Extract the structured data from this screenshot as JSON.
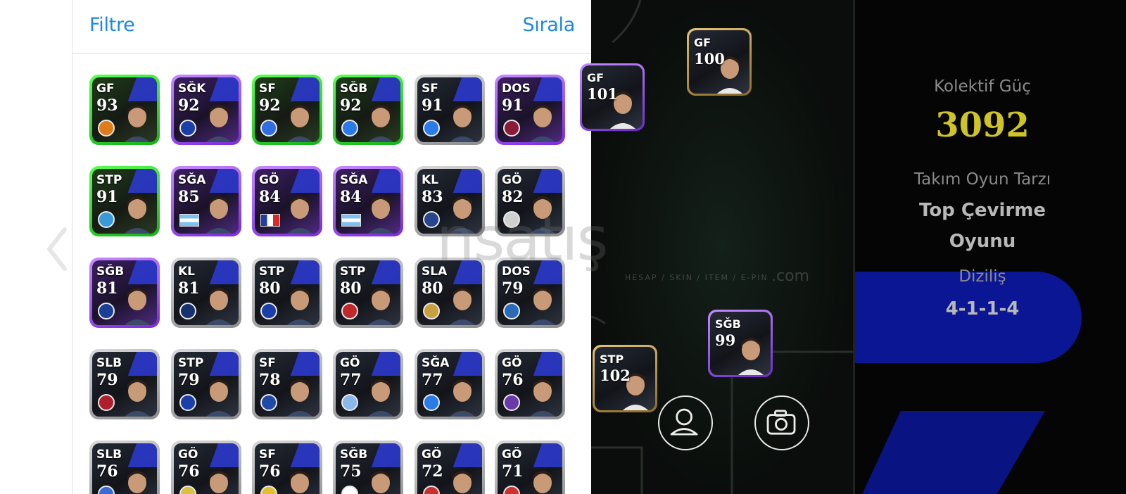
{
  "header": {
    "filter_label": "Filtre",
    "sort_label": "Sırala"
  },
  "cards": [
    {
      "pos": "GF",
      "rating": "93",
      "border": "green",
      "badge": "crest",
      "crest": "#e07b1a"
    },
    {
      "pos": "SĞK",
      "rating": "92",
      "border": "purple",
      "badge": "crest",
      "crest": "#1c3ea8"
    },
    {
      "pos": "SF",
      "rating": "92",
      "border": "green",
      "badge": "crest",
      "crest": "#2f6de0"
    },
    {
      "pos": "SĞB",
      "rating": "92",
      "border": "green",
      "badge": "crest",
      "crest": "#2a7be8"
    },
    {
      "pos": "SF",
      "rating": "91",
      "border": "grey",
      "badge": "crest",
      "crest": "#2a7be8"
    },
    {
      "pos": "DOS",
      "rating": "91",
      "border": "purple",
      "badge": "crest",
      "crest": "#8a1c3a"
    },
    {
      "pos": "STP",
      "rating": "91",
      "border": "green",
      "badge": "crest",
      "crest": "#3a9ad8"
    },
    {
      "pos": "SĞA",
      "rating": "85",
      "border": "purple",
      "badge": "flag",
      "flag": "argentina"
    },
    {
      "pos": "GÖ",
      "rating": "84",
      "border": "purple",
      "badge": "flag",
      "flag": "france"
    },
    {
      "pos": "SĞA",
      "rating": "84",
      "border": "purple",
      "badge": "flag",
      "flag": "argentina"
    },
    {
      "pos": "KL",
      "rating": "83",
      "border": "grey",
      "badge": "crest",
      "crest": "#27458f"
    },
    {
      "pos": "GÖ",
      "rating": "82",
      "border": "grey",
      "badge": "crest",
      "crest": "#d0d0d0"
    },
    {
      "pos": "SĞB",
      "rating": "81",
      "border": "purple",
      "badge": "crest",
      "crest": "#1b3f96"
    },
    {
      "pos": "KL",
      "rating": "81",
      "border": "grey",
      "badge": "crest",
      "crest": "#17306e"
    },
    {
      "pos": "STP",
      "rating": "80",
      "border": "grey",
      "badge": "crest",
      "crest": "#1c3ea8"
    },
    {
      "pos": "STP",
      "rating": "80",
      "border": "grey",
      "badge": "crest",
      "crest": "#c0282a"
    },
    {
      "pos": "SLA",
      "rating": "80",
      "border": "grey",
      "badge": "crest",
      "crest": "#c9a040"
    },
    {
      "pos": "DOS",
      "rating": "79",
      "border": "grey",
      "badge": "crest",
      "crest": "#2a6bb8"
    },
    {
      "pos": "SLB",
      "rating": "79",
      "border": "grey",
      "badge": "crest",
      "crest": "#b01e2e"
    },
    {
      "pos": "STP",
      "rating": "79",
      "border": "grey",
      "badge": "crest",
      "crest": "#1c3ea8"
    },
    {
      "pos": "SF",
      "rating": "78",
      "border": "grey",
      "badge": "crest",
      "crest": "#1f4aa8"
    },
    {
      "pos": "GÖ",
      "rating": "77",
      "border": "grey",
      "badge": "crest",
      "crest": "#8ab8e8"
    },
    {
      "pos": "SĞA",
      "rating": "77",
      "border": "grey",
      "badge": "crest",
      "crest": "#2a7be8"
    },
    {
      "pos": "GÖ",
      "rating": "76",
      "border": "grey",
      "badge": "crest",
      "crest": "#6a3aa8"
    },
    {
      "pos": "SLB",
      "rating": "76",
      "border": "grey",
      "badge": "crest",
      "crest": "#3a6ad8"
    },
    {
      "pos": "GÖ",
      "rating": "76",
      "border": "grey",
      "badge": "crest",
      "crest": "#d8c040"
    },
    {
      "pos": "SF",
      "rating": "76",
      "border": "grey",
      "badge": "crest",
      "crest": "#e0c030"
    },
    {
      "pos": "SĞB",
      "rating": "75",
      "border": "grey",
      "badge": "crest",
      "crest": "#ffffff"
    },
    {
      "pos": "GÖ",
      "rating": "72",
      "border": "grey",
      "badge": "crest",
      "crest": "#c83030"
    },
    {
      "pos": "GÖ",
      "rating": "71",
      "border": "grey",
      "badge": "crest",
      "crest": "#d03030"
    }
  ],
  "pitch_cards": [
    {
      "pos": "GF",
      "rating": "100",
      "border": "gold"
    },
    {
      "pos": "GF",
      "rating": "101",
      "border": "violet"
    },
    {
      "pos": "SĞB",
      "rating": "99",
      "border": "violet"
    },
    {
      "pos": "STP",
      "rating": "102",
      "border": "gold"
    }
  ],
  "pitch_buttons": {
    "profile_icon": "person-icon",
    "camera_icon": "camera-icon"
  },
  "watermark": {
    "text": "nsatış",
    "sub": "HESAP / SKIN / ITEM / E-PIN",
    "com": ".com"
  },
  "team_info": {
    "power_label": "Kolektif Güç",
    "power_value": "3092",
    "style_label": "Takım Oyun Tarzı",
    "style_value_line1": "Top Çevirme",
    "style_value_line2": "Oyunu",
    "formation_label": "Diziliş",
    "formation_value": "4-1-1-4"
  },
  "colors": {
    "accent": "#1e88e5",
    "power": "#cfc32a",
    "pitch": "#0a0d0b"
  }
}
